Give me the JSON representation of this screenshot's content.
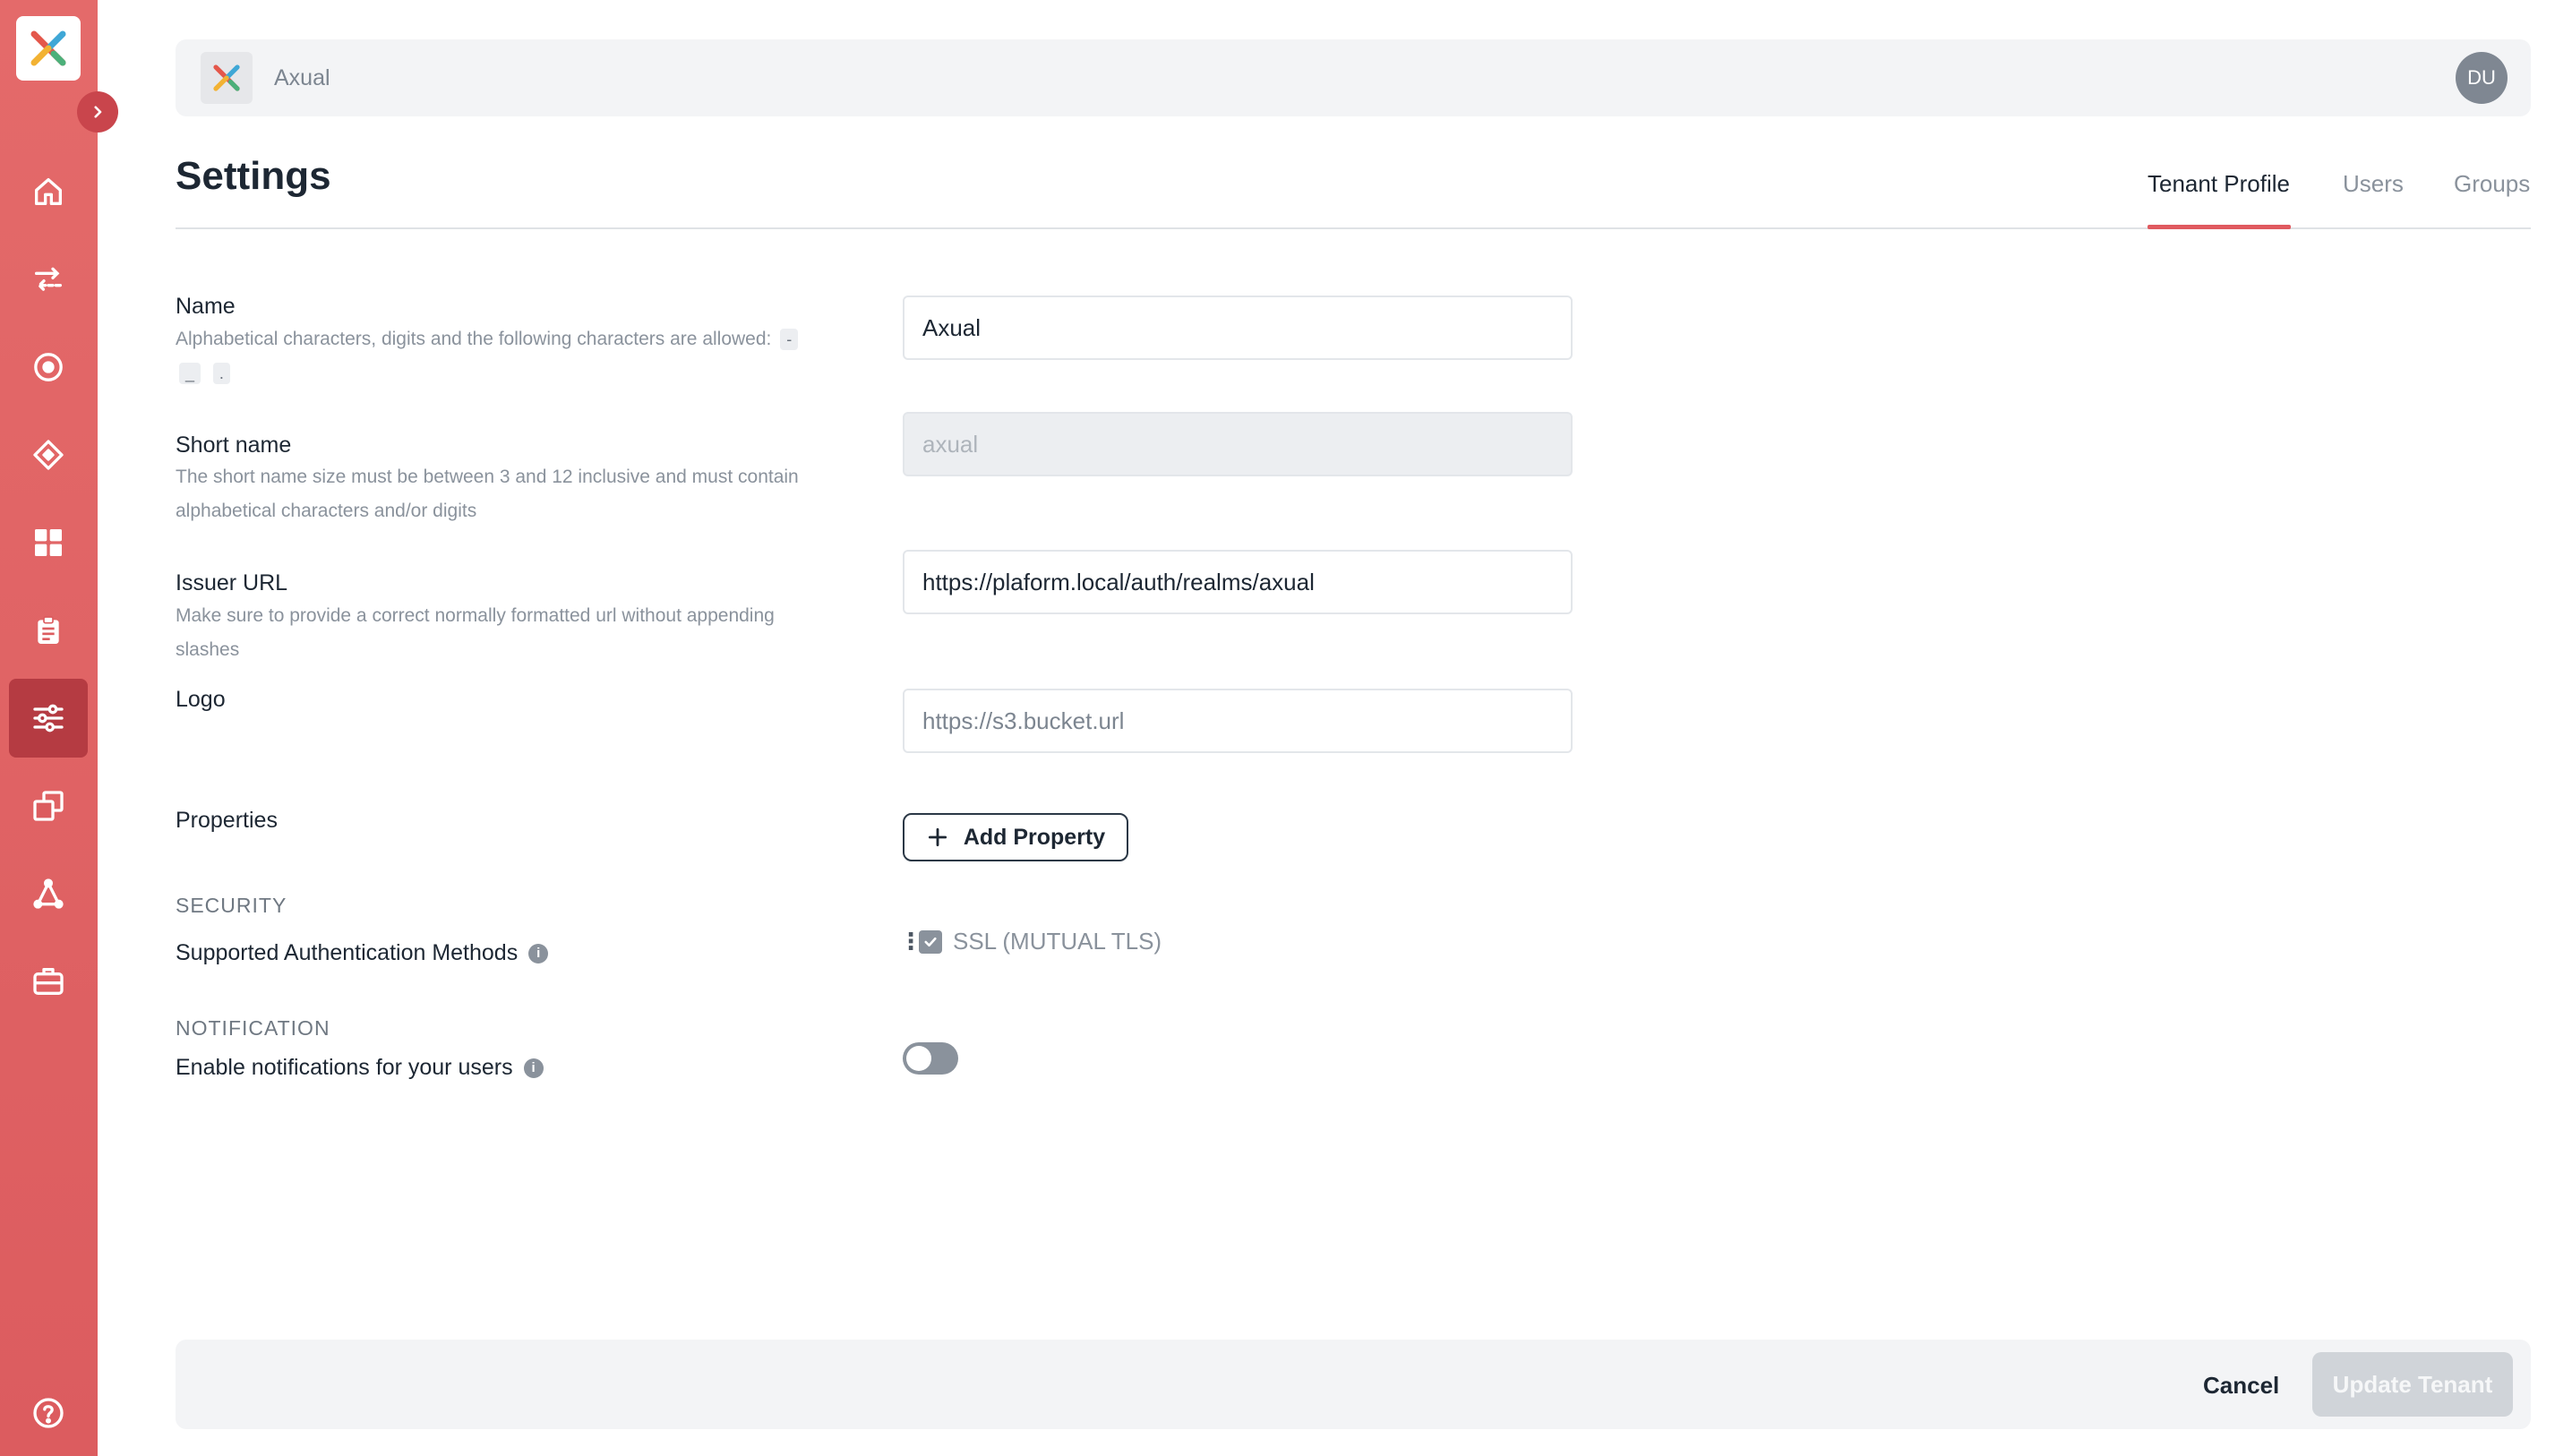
{
  "sidebar": {
    "items": [
      {
        "name": "home-icon"
      },
      {
        "name": "transfer-icon"
      },
      {
        "name": "target-icon"
      },
      {
        "name": "diamond-icon"
      },
      {
        "name": "dashboard-icon"
      },
      {
        "name": "clipboard-icon"
      },
      {
        "name": "settings-sliders-icon"
      },
      {
        "name": "copy-icon"
      },
      {
        "name": "network-icon"
      },
      {
        "name": "briefcase-icon"
      }
    ],
    "active_index": 6,
    "help_icon": "help-icon"
  },
  "topbar": {
    "tenant_name": "Axual",
    "avatar_initials": "DU"
  },
  "page": {
    "title": "Settings",
    "tabs": [
      {
        "label": "Tenant Profile"
      },
      {
        "label": "Users"
      },
      {
        "label": "Groups"
      }
    ],
    "active_tab": 0
  },
  "form": {
    "name": {
      "label": "Name",
      "help_text": "Alphabetical characters, digits and the following characters are allowed:",
      "allowed_chars": [
        "-",
        "_",
        "."
      ],
      "value": "Axual"
    },
    "short_name": {
      "label": "Short name",
      "help_text": "The short name size must be between 3 and 12 inclusive and must contain alphabetical characters and/or digits",
      "value": "axual"
    },
    "issuer_url": {
      "label": "Issuer URL",
      "help_text": "Make sure to provide a correct normally formatted url without appending slashes",
      "value": "https://plaform.local/auth/realms/axual"
    },
    "logo": {
      "label": "Logo",
      "placeholder": "https://s3.bucket.url"
    },
    "properties": {
      "label": "Properties",
      "add_button": "Add Property"
    },
    "security": {
      "section_title": "SECURITY",
      "label": "Supported Authentication Methods",
      "methods": [
        {
          "label": "SSL (MUTUAL TLS)",
          "checked": true
        }
      ]
    },
    "notification": {
      "section_title": "NOTIFICATION",
      "label": "Enable notifications for your users",
      "enabled": false
    }
  },
  "footer": {
    "cancel_label": "Cancel",
    "update_label": "Update Tenant"
  },
  "colors": {
    "sidebar": "#e46a6a",
    "sidebar_active": "#b53b42",
    "accent": "#e05a5f"
  }
}
